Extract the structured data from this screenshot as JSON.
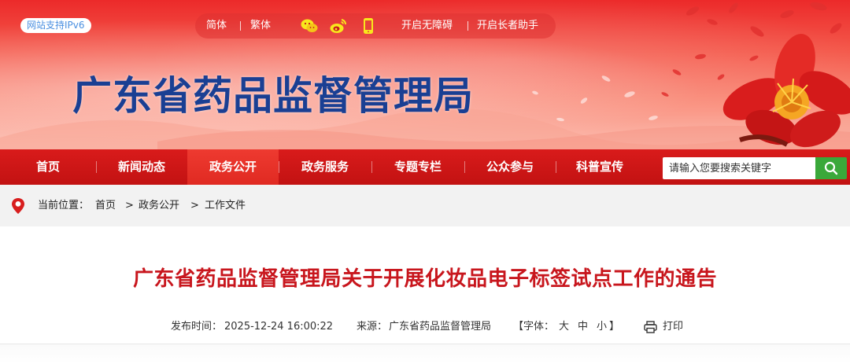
{
  "header": {
    "ipv6_badge": "网站支持IPv6",
    "toolbar": {
      "simplified": "简体",
      "traditional": "繁体",
      "icons": [
        "wechat-icon",
        "weibo-icon",
        "phone-icon"
      ],
      "accessible": "开启无障碍",
      "elder_helper": "开启长者助手"
    },
    "site_title": "广东省药品监督管理局"
  },
  "nav": {
    "items": [
      {
        "label": "首页"
      },
      {
        "label": "新闻动态"
      },
      {
        "label": "政务公开"
      },
      {
        "label": "政务服务"
      },
      {
        "label": "专题专栏"
      },
      {
        "label": "公众参与"
      },
      {
        "label": "科普宣传"
      }
    ],
    "active": "政务公开"
  },
  "search": {
    "placeholder": "请输入您要搜索关键字"
  },
  "breadcrumb": {
    "prefix": "当前位置：",
    "items": [
      "首页",
      "政务公开",
      "工作文件"
    ],
    "separator": ">"
  },
  "article": {
    "title": "广东省药品监督管理局关于开展化妆品电子标签试点工作的通告",
    "publish_label": "发布时间：",
    "publish_time": "2025-12-24 16:00:22",
    "source_label": "来源：",
    "source": "广东省药品监督管理局",
    "font_label": "【字体：",
    "font_large": "大",
    "font_medium": "中",
    "font_small": "小",
    "font_close": "】",
    "print": "打印"
  },
  "colors": {
    "nav_bg": "#c8161d",
    "title_red": "#c8161d",
    "site_title_blue": "#1a3f93",
    "search_green": "#3aa83a"
  }
}
